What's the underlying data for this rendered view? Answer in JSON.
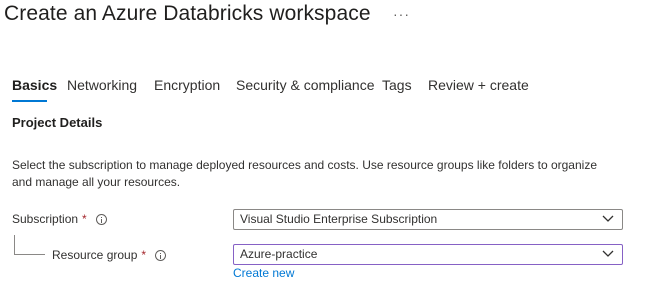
{
  "header": {
    "title": "Create an Azure Databricks workspace",
    "more_label": "···"
  },
  "tabs": [
    {
      "label": "Basics",
      "active": true
    },
    {
      "label": "Networking",
      "active": false
    },
    {
      "label": "Encryption",
      "active": false
    },
    {
      "label": "Security & compliance",
      "active": false
    },
    {
      "label": "Tags",
      "active": false
    },
    {
      "label": "Review + create",
      "active": false
    }
  ],
  "project_details": {
    "heading": "Project Details",
    "description": "Select the subscription to manage deployed resources and costs. Use resource groups like folders to organize and manage all your resources.",
    "required_marker": "*",
    "subscription": {
      "label": "Subscription",
      "value": "Visual Studio Enterprise Subscription"
    },
    "resource_group": {
      "label": "Resource group",
      "value": "Azure-practice",
      "create_new_label": "Create new"
    }
  },
  "colors": {
    "accent": "#0078d4",
    "required": "#a4262c",
    "focus_border": "#8661c5"
  }
}
